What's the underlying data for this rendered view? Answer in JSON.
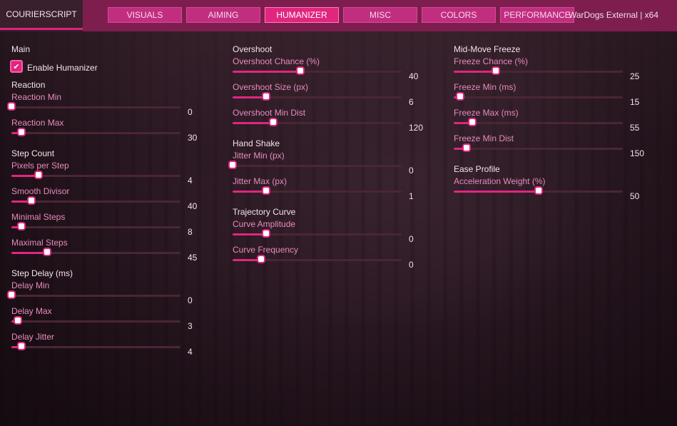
{
  "app": {
    "brand": "COURIERSCRIPT",
    "window_title": "WarDogs External | x64"
  },
  "tabs": [
    {
      "label": "VISUALS",
      "active": false
    },
    {
      "label": "AIMING",
      "active": false
    },
    {
      "label": "HUMANIZER",
      "active": true
    },
    {
      "label": "MISC",
      "active": false
    },
    {
      "label": "COLORS",
      "active": false
    },
    {
      "label": "PERFORMANCE",
      "active": false
    }
  ],
  "colors": {
    "accent": "#e0267f",
    "topbar": "#7d1e4f",
    "label": "#e68bbc"
  },
  "col1": {
    "main": "Main",
    "enable_humanizer": {
      "label": "Enable Humanizer",
      "checked": true
    },
    "reaction": "Reaction",
    "reaction_min": {
      "label": "Reaction Min",
      "value": "0",
      "fraction": 0.0
    },
    "reaction_max": {
      "label": "Reaction Max",
      "value": "30",
      "fraction": 0.06
    },
    "step_count": "Step Count",
    "pixels_per_step": {
      "label": "Pixels per Step",
      "value": "4",
      "fraction": 0.16
    },
    "smooth_divisor": {
      "label": "Smooth Divisor",
      "value": "40",
      "fraction": 0.12
    },
    "minimal_steps": {
      "label": "Minimal Steps",
      "value": "8",
      "fraction": 0.06
    },
    "maximal_steps": {
      "label": "Maximal Steps",
      "value": "45",
      "fraction": 0.21
    },
    "step_delay": "Step Delay (ms)",
    "delay_min": {
      "label": "Delay Min",
      "value": "0",
      "fraction": 0.0
    },
    "delay_max": {
      "label": "Delay Max",
      "value": "3",
      "fraction": 0.04
    },
    "delay_jitter": {
      "label": "Delay Jitter",
      "value": "4",
      "fraction": 0.06
    }
  },
  "col2": {
    "overshoot": "Overshoot",
    "overshoot_chance": {
      "label": "Overshoot Chance (%)",
      "value": "40",
      "fraction": 0.4
    },
    "overshoot_size": {
      "label": "Overshoot Size (px)",
      "value": "6",
      "fraction": 0.2
    },
    "overshoot_min_dist": {
      "label": "Overshoot Min Dist",
      "value": "120",
      "fraction": 0.24
    },
    "hand_shake": "Hand Shake",
    "jitter_min": {
      "label": "Jitter Min (px)",
      "value": "0",
      "fraction": 0.0
    },
    "jitter_max": {
      "label": "Jitter Max (px)",
      "value": "1",
      "fraction": 0.2
    },
    "trajectory_curve": "Trajectory Curve",
    "curve_amplitude": {
      "label": "Curve Amplitude",
      "value": "0",
      "fraction": 0.2
    },
    "curve_frequency": {
      "label": "Curve Frequency",
      "value": "0",
      "fraction": 0.17
    }
  },
  "col3": {
    "mid_move_freeze": "Mid-Move Freeze",
    "freeze_chance": {
      "label": "Freeze Chance (%)",
      "value": "25",
      "fraction": 0.25
    },
    "freeze_min": {
      "label": "Freeze Min (ms)",
      "value": "15",
      "fraction": 0.04
    },
    "freeze_max": {
      "label": "Freeze Max (ms)",
      "value": "55",
      "fraction": 0.11
    },
    "freeze_min_dist": {
      "label": "Freeze Min Dist",
      "value": "150",
      "fraction": 0.075
    },
    "ease_profile": "Ease Profile",
    "acceleration_weight": {
      "label": "Acceleration Weight (%)",
      "value": "50",
      "fraction": 0.5
    }
  }
}
